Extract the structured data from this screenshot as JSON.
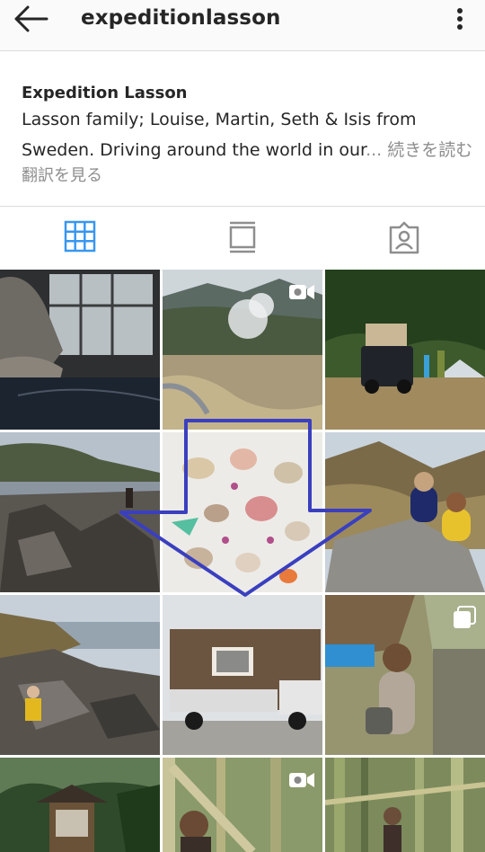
{
  "header": {
    "username": "expeditionlasson",
    "back_icon": "arrow-left-icon",
    "more_icon": "more-vertical-icon"
  },
  "bio": {
    "name": "Expedition Lasson",
    "line1": "Lasson family; Louise, Martin, Seth & Isis from",
    "line2_text": "Sweden. Driving around the world in our",
    "line2_ellipsis": "...",
    "more": "続きを読む",
    "translate": "翻訳を見る"
  },
  "tabs": [
    {
      "icon": "grid-icon",
      "active": true
    },
    {
      "icon": "feed-icon",
      "active": false
    },
    {
      "icon": "tagged-icon",
      "active": false
    }
  ],
  "colors": {
    "accent": "#3897f0",
    "arrow_overlay": "#3a3fbf"
  }
}
